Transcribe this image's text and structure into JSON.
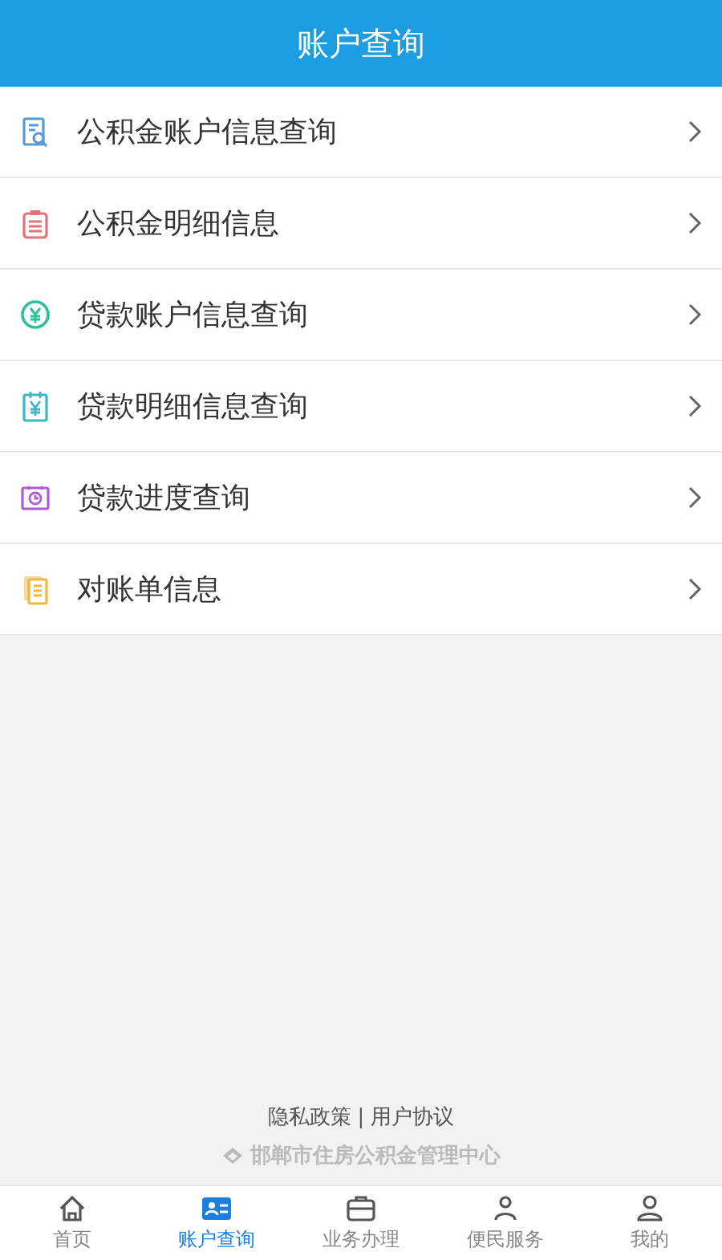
{
  "header": {
    "title": "账户查询"
  },
  "menu": [
    {
      "label": "公积金账户信息查询",
      "kind": "search-doc",
      "color": "#5b9bd5"
    },
    {
      "label": "公积金明细信息",
      "kind": "clipboard",
      "color": "#e5707a"
    },
    {
      "label": "贷款账户信息查询",
      "kind": "coin",
      "color": "#2cc19a"
    },
    {
      "label": "贷款明细信息查询",
      "kind": "yen-doc",
      "color": "#3bb8c4"
    },
    {
      "label": "贷款进度查询",
      "kind": "clock",
      "color": "#b05bd8"
    },
    {
      "label": "对账单信息",
      "kind": "pages",
      "color": "#f0b840"
    }
  ],
  "footer": {
    "links": [
      "隐私政策",
      "用户协议"
    ],
    "separator": "|",
    "organization": "邯郸市住房公积金管理中心"
  },
  "tabbar": [
    {
      "label": "首页",
      "kind": "home",
      "selected": false
    },
    {
      "label": "账户查询",
      "kind": "card",
      "selected": true
    },
    {
      "label": "业务办理",
      "kind": "briefcase",
      "selected": false
    },
    {
      "label": "便民服务",
      "kind": "people",
      "selected": false
    },
    {
      "label": "我的",
      "kind": "user",
      "selected": false
    }
  ]
}
